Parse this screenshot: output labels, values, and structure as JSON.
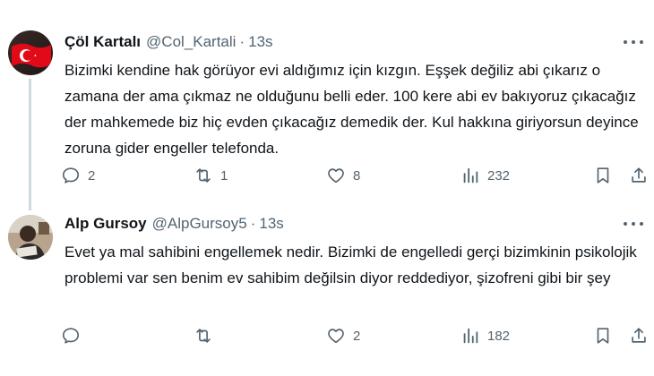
{
  "tweets": [
    {
      "name": "Çöl Kartalı",
      "handle": "@Col_Kartali",
      "time": "13s",
      "text": "Bizimki kendine hak görüyor evi aldığımız için kızgın. Eşşek değiliz abi çıkarız o zamana der ama çıkmaz ne olduğunu belli eder. 100 kere abi ev bakıyoruz çıkacağız der mahkemede biz hiç evden çıkacağız demedik der. Kul hakkına giriyorsun deyince zoruna gider engeller telefonda.",
      "replies": "2",
      "retweets": "1",
      "likes": "8",
      "views": "232",
      "avatar_icon": "turkish-flag-avatar"
    },
    {
      "name": "Alp Gursoy",
      "handle": "@AlpGursoy5",
      "time": "13s",
      "text": "Evet ya mal sahibini engellemek nedir. Bizimki de engelledi gerçi bizimkinin psikolojik problemi var sen benim ev sahibim değilsin diyor reddediyor, şizofreni gibi bir şey",
      "replies": "",
      "retweets": "",
      "likes": "2",
      "views": "182",
      "avatar_icon": "person-photo-avatar"
    }
  ],
  "colors": {
    "text": "#0f1419",
    "secondary": "#536471",
    "thread_line": "#cfd9de",
    "flag_red": "#e30a17"
  }
}
